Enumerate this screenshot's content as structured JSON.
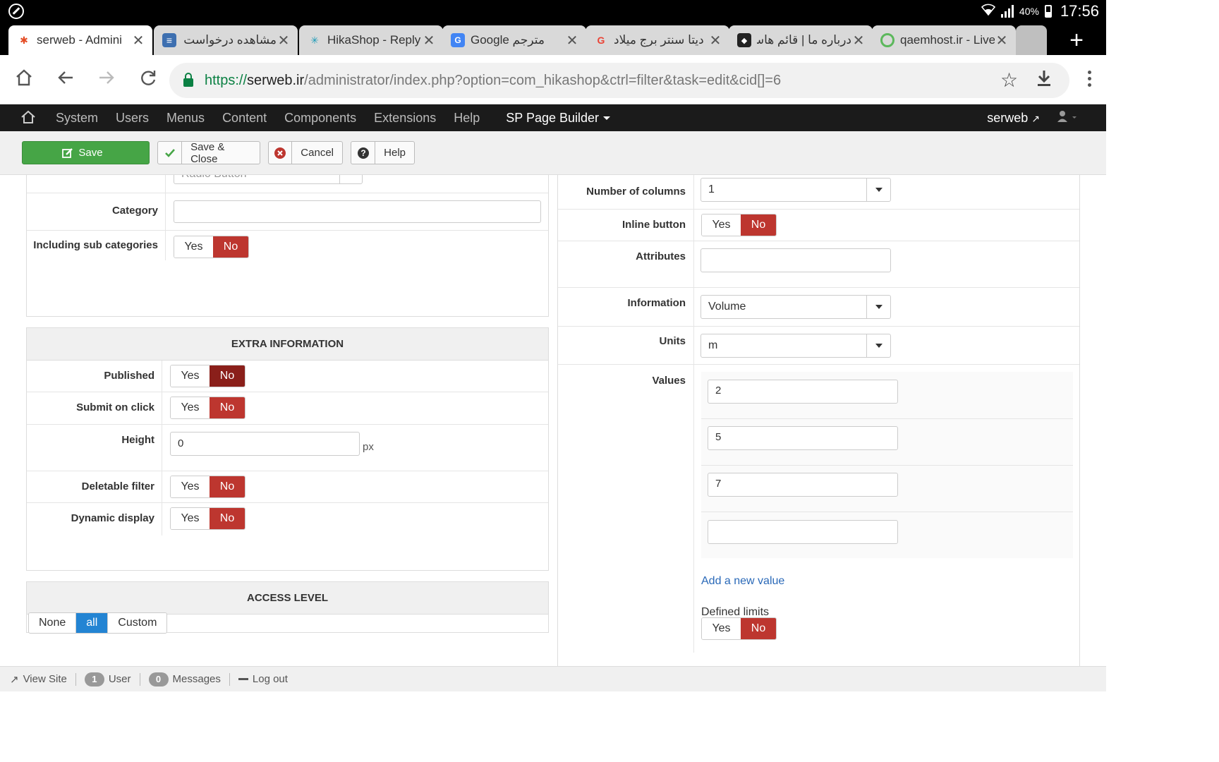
{
  "status_bar": {
    "battery": "40%",
    "time": "17:56"
  },
  "tabs": [
    {
      "title": "serweb - Admini",
      "icon": "joomla-icon",
      "active": true
    },
    {
      "title": "مشاهده درخواست -",
      "icon": "database-icon",
      "rtl": true
    },
    {
      "title": "HikaShop - Reply",
      "icon": "hikashop-icon"
    },
    {
      "title": "Google مترجم",
      "icon": "google-translate-icon"
    },
    {
      "title": "دیتا سنتر برج میلاد",
      "icon": "google-icon",
      "rtl": true
    },
    {
      "title": "درباره ما | قائم هاست",
      "icon": "shield-icon",
      "rtl": true
    },
    {
      "title": "qaemhost.ir - Live",
      "icon": "chat-icon"
    }
  ],
  "address": {
    "scheme": "https://",
    "host": "serweb.ir",
    "path": "/administrator/index.php?option=com_hikashop&ctrl=filter&task=edit&cid[]=6"
  },
  "admin_nav": {
    "items": [
      "System",
      "Users",
      "Menus",
      "Content",
      "Components",
      "Extensions",
      "Help"
    ],
    "sp_page_builder": "SP Page Builder",
    "site_name": "serweb"
  },
  "toolbar": {
    "save": "Save",
    "save_close": "Save & Close",
    "cancel": "Cancel",
    "help": "Help"
  },
  "left": {
    "top_field_value": "Radio Button",
    "category_label": "Category",
    "category_value": "",
    "sub_categories_label": "Including sub categories",
    "extra_info_title": "EXTRA INFORMATION",
    "published_label": "Published",
    "submit_on_click_label": "Submit on click",
    "height_label": "Height",
    "height_value": "0",
    "height_unit": "px",
    "deletable_label": "Deletable filter",
    "dynamic_label": "Dynamic display",
    "access_title": "ACCESS LEVEL",
    "access_options": [
      "None",
      "all",
      "Custom"
    ]
  },
  "right": {
    "columns_label": "Number of columns",
    "columns_value": "1",
    "inline_label": "Inline button",
    "attributes_label": "Attributes",
    "attributes_value": "",
    "information_label": "Information",
    "information_value": "Volume",
    "units_label": "Units",
    "units_value": "m",
    "values_label": "Values",
    "values": [
      "2",
      "5",
      "7",
      ""
    ],
    "add_value_link": "Add a new value",
    "defined_limits_label": "Defined limits"
  },
  "toggle": {
    "yes": "Yes",
    "no": "No"
  },
  "footer": {
    "view_site": "View Site",
    "user_count": "1",
    "user_label": "User",
    "messages_count": "0",
    "messages_label": "Messages",
    "logout": "Log out"
  },
  "colors": {
    "save_green": "#46a546",
    "no_red": "#bd362f",
    "access_blue": "#2384d3",
    "admin_bar": "#1b1b1b",
    "link_blue": "#2a69b8"
  }
}
